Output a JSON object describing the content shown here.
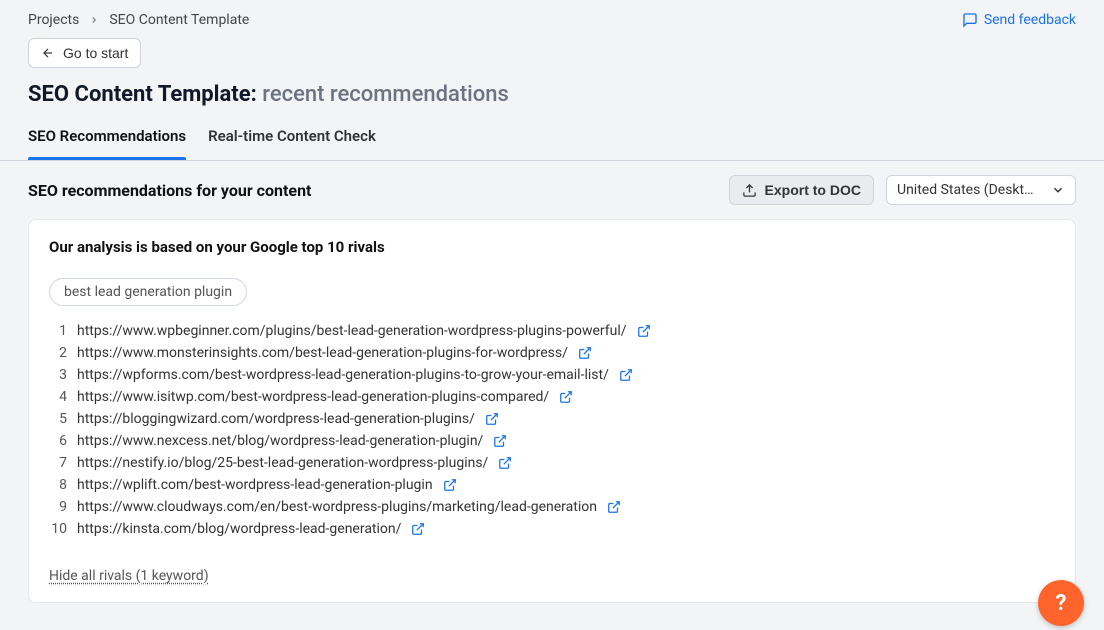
{
  "breadcrumb": {
    "root": "Projects",
    "current": "SEO Content Template"
  },
  "feedback_label": "Send feedback",
  "go_to_start_label": "Go to start",
  "page_title_prefix": "SEO Content Template:",
  "page_title_scope": "recent recommendations",
  "tabs": [
    {
      "label": "SEO Recommendations",
      "active": true
    },
    {
      "label": "Real-time Content Check",
      "active": false
    }
  ],
  "section_heading": "SEO recommendations for your content",
  "export_label": "Export to DOC",
  "region_label": "United States (Deskt…",
  "card": {
    "title": "Our analysis is based on your Google top 10 rivals",
    "keyword": "best lead generation plugin",
    "rivals": [
      "https://www.wpbeginner.com/plugins/best-lead-generation-wordpress-plugins-powerful/",
      "https://www.monsterinsights.com/best-lead-generation-plugins-for-wordpress/",
      "https://wpforms.com/best-wordpress-lead-generation-plugins-to-grow-your-email-list/",
      "https://www.isitwp.com/best-wordpress-lead-generation-plugins-compared/",
      "https://bloggingwizard.com/wordpress-lead-generation-plugins/",
      "https://www.nexcess.net/blog/wordpress-lead-generation-plugin/",
      "https://nestify.io/blog/25-best-lead-generation-wordpress-plugins/",
      "https://wplift.com/best-wordpress-lead-generation-plugin",
      "https://www.cloudways.com/en/best-wordpress-plugins/marketing/lead-generation",
      "https://kinsta.com/blog/wordpress-lead-generation/"
    ],
    "hide_link": "Hide all rivals (1 keyword)"
  },
  "help_glyph": "?"
}
